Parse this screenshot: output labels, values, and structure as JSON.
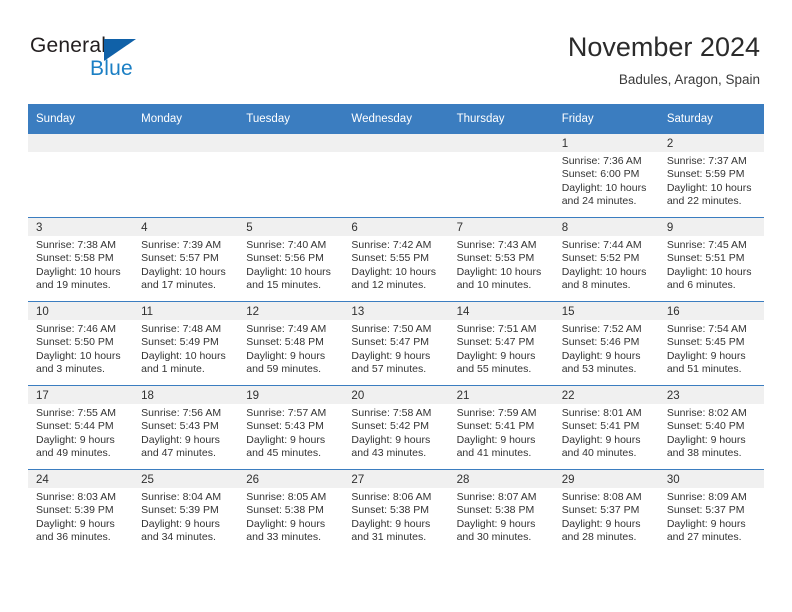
{
  "brand": {
    "name_part1": "General",
    "name_part2": "Blue",
    "triangle_color": "#1061a8",
    "blue_color": "#1b7fc4"
  },
  "header": {
    "title": "November 2024",
    "subtitle": "Badules, Aragon, Spain"
  },
  "theme": {
    "header_blue": "#3b7dc0",
    "day_band_gray": "#f0f0f0",
    "text_color": "#333333"
  },
  "weekdays": [
    "Sunday",
    "Monday",
    "Tuesday",
    "Wednesday",
    "Thursday",
    "Friday",
    "Saturday"
  ],
  "weeks": [
    [
      {
        "day": "",
        "lines": []
      },
      {
        "day": "",
        "lines": []
      },
      {
        "day": "",
        "lines": []
      },
      {
        "day": "",
        "lines": []
      },
      {
        "day": "",
        "lines": []
      },
      {
        "day": "1",
        "lines": [
          "Sunrise: 7:36 AM",
          "Sunset: 6:00 PM",
          "Daylight: 10 hours",
          "and 24 minutes."
        ]
      },
      {
        "day": "2",
        "lines": [
          "Sunrise: 7:37 AM",
          "Sunset: 5:59 PM",
          "Daylight: 10 hours",
          "and 22 minutes."
        ]
      }
    ],
    [
      {
        "day": "3",
        "lines": [
          "Sunrise: 7:38 AM",
          "Sunset: 5:58 PM",
          "Daylight: 10 hours",
          "and 19 minutes."
        ]
      },
      {
        "day": "4",
        "lines": [
          "Sunrise: 7:39 AM",
          "Sunset: 5:57 PM",
          "Daylight: 10 hours",
          "and 17 minutes."
        ]
      },
      {
        "day": "5",
        "lines": [
          "Sunrise: 7:40 AM",
          "Sunset: 5:56 PM",
          "Daylight: 10 hours",
          "and 15 minutes."
        ]
      },
      {
        "day": "6",
        "lines": [
          "Sunrise: 7:42 AM",
          "Sunset: 5:55 PM",
          "Daylight: 10 hours",
          "and 12 minutes."
        ]
      },
      {
        "day": "7",
        "lines": [
          "Sunrise: 7:43 AM",
          "Sunset: 5:53 PM",
          "Daylight: 10 hours",
          "and 10 minutes."
        ]
      },
      {
        "day": "8",
        "lines": [
          "Sunrise: 7:44 AM",
          "Sunset: 5:52 PM",
          "Daylight: 10 hours",
          "and 8 minutes."
        ]
      },
      {
        "day": "9",
        "lines": [
          "Sunrise: 7:45 AM",
          "Sunset: 5:51 PM",
          "Daylight: 10 hours",
          "and 6 minutes."
        ]
      }
    ],
    [
      {
        "day": "10",
        "lines": [
          "Sunrise: 7:46 AM",
          "Sunset: 5:50 PM",
          "Daylight: 10 hours",
          "and 3 minutes."
        ]
      },
      {
        "day": "11",
        "lines": [
          "Sunrise: 7:48 AM",
          "Sunset: 5:49 PM",
          "Daylight: 10 hours",
          "and 1 minute."
        ]
      },
      {
        "day": "12",
        "lines": [
          "Sunrise: 7:49 AM",
          "Sunset: 5:48 PM",
          "Daylight: 9 hours",
          "and 59 minutes."
        ]
      },
      {
        "day": "13",
        "lines": [
          "Sunrise: 7:50 AM",
          "Sunset: 5:47 PM",
          "Daylight: 9 hours",
          "and 57 minutes."
        ]
      },
      {
        "day": "14",
        "lines": [
          "Sunrise: 7:51 AM",
          "Sunset: 5:47 PM",
          "Daylight: 9 hours",
          "and 55 minutes."
        ]
      },
      {
        "day": "15",
        "lines": [
          "Sunrise: 7:52 AM",
          "Sunset: 5:46 PM",
          "Daylight: 9 hours",
          "and 53 minutes."
        ]
      },
      {
        "day": "16",
        "lines": [
          "Sunrise: 7:54 AM",
          "Sunset: 5:45 PM",
          "Daylight: 9 hours",
          "and 51 minutes."
        ]
      }
    ],
    [
      {
        "day": "17",
        "lines": [
          "Sunrise: 7:55 AM",
          "Sunset: 5:44 PM",
          "Daylight: 9 hours",
          "and 49 minutes."
        ]
      },
      {
        "day": "18",
        "lines": [
          "Sunrise: 7:56 AM",
          "Sunset: 5:43 PM",
          "Daylight: 9 hours",
          "and 47 minutes."
        ]
      },
      {
        "day": "19",
        "lines": [
          "Sunrise: 7:57 AM",
          "Sunset: 5:43 PM",
          "Daylight: 9 hours",
          "and 45 minutes."
        ]
      },
      {
        "day": "20",
        "lines": [
          "Sunrise: 7:58 AM",
          "Sunset: 5:42 PM",
          "Daylight: 9 hours",
          "and 43 minutes."
        ]
      },
      {
        "day": "21",
        "lines": [
          "Sunrise: 7:59 AM",
          "Sunset: 5:41 PM",
          "Daylight: 9 hours",
          "and 41 minutes."
        ]
      },
      {
        "day": "22",
        "lines": [
          "Sunrise: 8:01 AM",
          "Sunset: 5:41 PM",
          "Daylight: 9 hours",
          "and 40 minutes."
        ]
      },
      {
        "day": "23",
        "lines": [
          "Sunrise: 8:02 AM",
          "Sunset: 5:40 PM",
          "Daylight: 9 hours",
          "and 38 minutes."
        ]
      }
    ],
    [
      {
        "day": "24",
        "lines": [
          "Sunrise: 8:03 AM",
          "Sunset: 5:39 PM",
          "Daylight: 9 hours",
          "and 36 minutes."
        ]
      },
      {
        "day": "25",
        "lines": [
          "Sunrise: 8:04 AM",
          "Sunset: 5:39 PM",
          "Daylight: 9 hours",
          "and 34 minutes."
        ]
      },
      {
        "day": "26",
        "lines": [
          "Sunrise: 8:05 AM",
          "Sunset: 5:38 PM",
          "Daylight: 9 hours",
          "and 33 minutes."
        ]
      },
      {
        "day": "27",
        "lines": [
          "Sunrise: 8:06 AM",
          "Sunset: 5:38 PM",
          "Daylight: 9 hours",
          "and 31 minutes."
        ]
      },
      {
        "day": "28",
        "lines": [
          "Sunrise: 8:07 AM",
          "Sunset: 5:38 PM",
          "Daylight: 9 hours",
          "and 30 minutes."
        ]
      },
      {
        "day": "29",
        "lines": [
          "Sunrise: 8:08 AM",
          "Sunset: 5:37 PM",
          "Daylight: 9 hours",
          "and 28 minutes."
        ]
      },
      {
        "day": "30",
        "lines": [
          "Sunrise: 8:09 AM",
          "Sunset: 5:37 PM",
          "Daylight: 9 hours",
          "and 27 minutes."
        ]
      }
    ]
  ]
}
